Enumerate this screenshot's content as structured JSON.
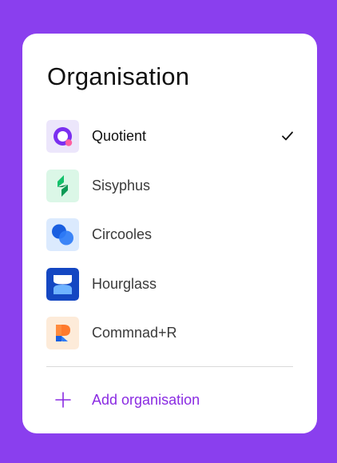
{
  "page": {
    "title": "Organisation"
  },
  "organisations": [
    {
      "name": "Quotient",
      "icon": "quotient-logo",
      "selected": true
    },
    {
      "name": "Sisyphus",
      "icon": "sisyphus-logo",
      "selected": false
    },
    {
      "name": "Circooles",
      "icon": "circooles-logo",
      "selected": false
    },
    {
      "name": "Hourglass",
      "icon": "hourglass-logo",
      "selected": false
    },
    {
      "name": "Commnad+R",
      "icon": "commnad-r-logo",
      "selected": false
    }
  ],
  "selected_indicator_icon": "checkmark-icon",
  "add_action": {
    "label": "Add organisation",
    "icon": "plus-icon"
  },
  "colors": {
    "background": "#8a3fee",
    "card": "#ffffff",
    "accent": "#8a2be2",
    "divider": "#d9d9d9"
  }
}
